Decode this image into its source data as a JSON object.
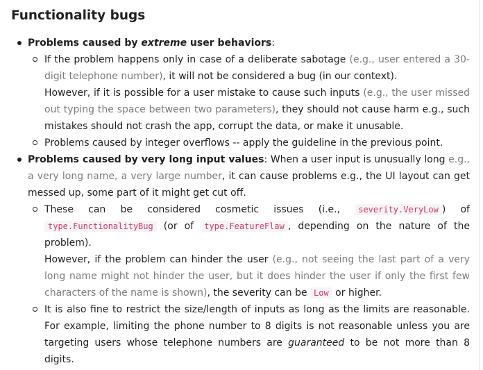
{
  "heading": "Functionality bugs",
  "item1": {
    "title_pre": "Problems caused by ",
    "title_em": "extreme",
    "title_post": " user behaviors",
    "colon": ":",
    "sub1": {
      "t1": "If the problem happens only in case of a deliberate sabotage ",
      "g1": "(e.g., user entered a 30-digit telephone number)",
      "t2": ", it will not be considered a bug (in our context).",
      "t3": "However, if it is possible for a user mistake to cause such inputs ",
      "g2": "(e.g., the user missed out typing the space between two parameters)",
      "t4": ", they should not cause harm e.g., such mistakes should not crash the app, corrupt the data, or make it unusable."
    },
    "sub2": "Problems caused by integer overflows -- apply the guideline in the previous point."
  },
  "item2": {
    "title": "Problems caused by very long input values",
    "t1": ": When a user input is unusually long ",
    "g1": "e.g., a very long name, a very large number",
    "t2": ", it can cause problems e.g., the UI layout can get messed up, some part of it might get cut off.",
    "sub1": {
      "t1": "These can be considered cosmetic issues (i.e., ",
      "c1": "severity.VeryLow",
      "t2": ") of ",
      "c2": "type.FunctionalityBug",
      "t3": " (or of ",
      "c3": "type.FeatureFlaw",
      "t4": ", depending on the nature of the problem).",
      "t5": "However, if the problem can hinder the user ",
      "g1": "(e.g., not seeing the last part of a very long name might not hinder the user, but it does hinder the user if only the first few characters of the name is shown)",
      "t6": ", the severity can be ",
      "c4": "Low",
      "t7": " or higher."
    },
    "sub2": {
      "t1": "It is also fine to restrict the size/length of inputs as long as the limits are reasonable. For example, limiting the phone number to 8 digits is not reasonable unless you are targeting users whose telephone numbers are ",
      "em": "guaranteed",
      "t2": " to be not more than 8 digits."
    }
  }
}
